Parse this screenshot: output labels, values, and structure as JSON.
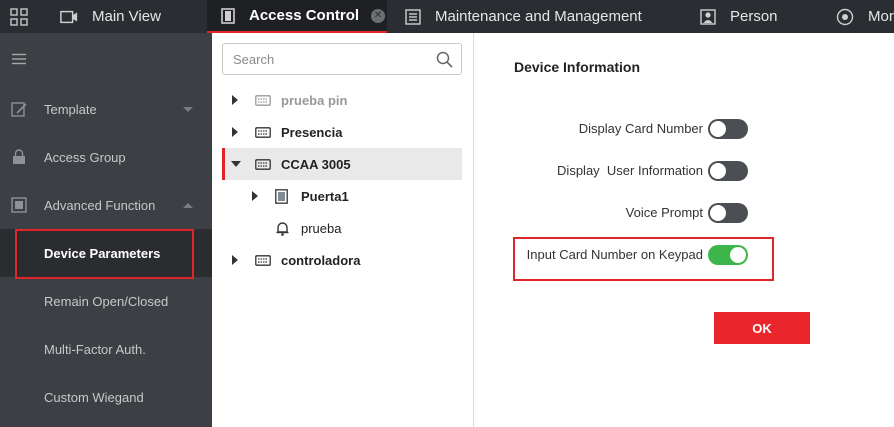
{
  "colors": {
    "accent": "#e0262b",
    "toggle_on": "#3cb54a",
    "toggle_off": "#4b4e52",
    "sidebar_bg": "#3c3f43",
    "topbar_bg": "#2a2d31"
  },
  "topbar": {
    "tabs": [
      {
        "label": "Main View",
        "icon": "monitor-icon"
      },
      {
        "label": "Access Control",
        "icon": "door-icon",
        "active": true
      },
      {
        "label": "Maintenance and Management",
        "icon": "settings-panel-icon"
      },
      {
        "label": "Person",
        "icon": "person-icon"
      },
      {
        "label": "Mor",
        "icon": "target-icon"
      }
    ]
  },
  "sidebar": {
    "items": [
      {
        "label": "Template",
        "icon": "template-icon"
      },
      {
        "label": "Access Group",
        "icon": "lock-icon"
      },
      {
        "label": "Advanced Function",
        "icon": "advanced-function-icon"
      },
      {
        "label": "Device Parameters",
        "selected": true
      },
      {
        "label": "Remain Open/Closed"
      },
      {
        "label": "Multi-Factor Auth."
      },
      {
        "label": "Custom Wiegand"
      }
    ]
  },
  "tree": {
    "search_placeholder": "Search",
    "nodes": [
      {
        "label": "prueba pin",
        "icon": "controller-icon"
      },
      {
        "label": "Presencia",
        "icon": "controller-icon"
      },
      {
        "label": "CCAA 3005",
        "icon": "controller-icon"
      },
      {
        "label": "Puerta1",
        "icon": "door-icon"
      },
      {
        "label": "prueba",
        "icon": "bell-icon"
      },
      {
        "label": "controladora",
        "icon": "controller-icon"
      }
    ]
  },
  "content": {
    "title": "Device Information",
    "settings": [
      {
        "label": "Display Card Number",
        "on": false
      },
      {
        "label": "Display  User Information",
        "on": false
      },
      {
        "label": "Voice Prompt",
        "on": false
      },
      {
        "label": "Input Card Number on Keypad",
        "on": true
      }
    ],
    "ok_label": "OK"
  }
}
